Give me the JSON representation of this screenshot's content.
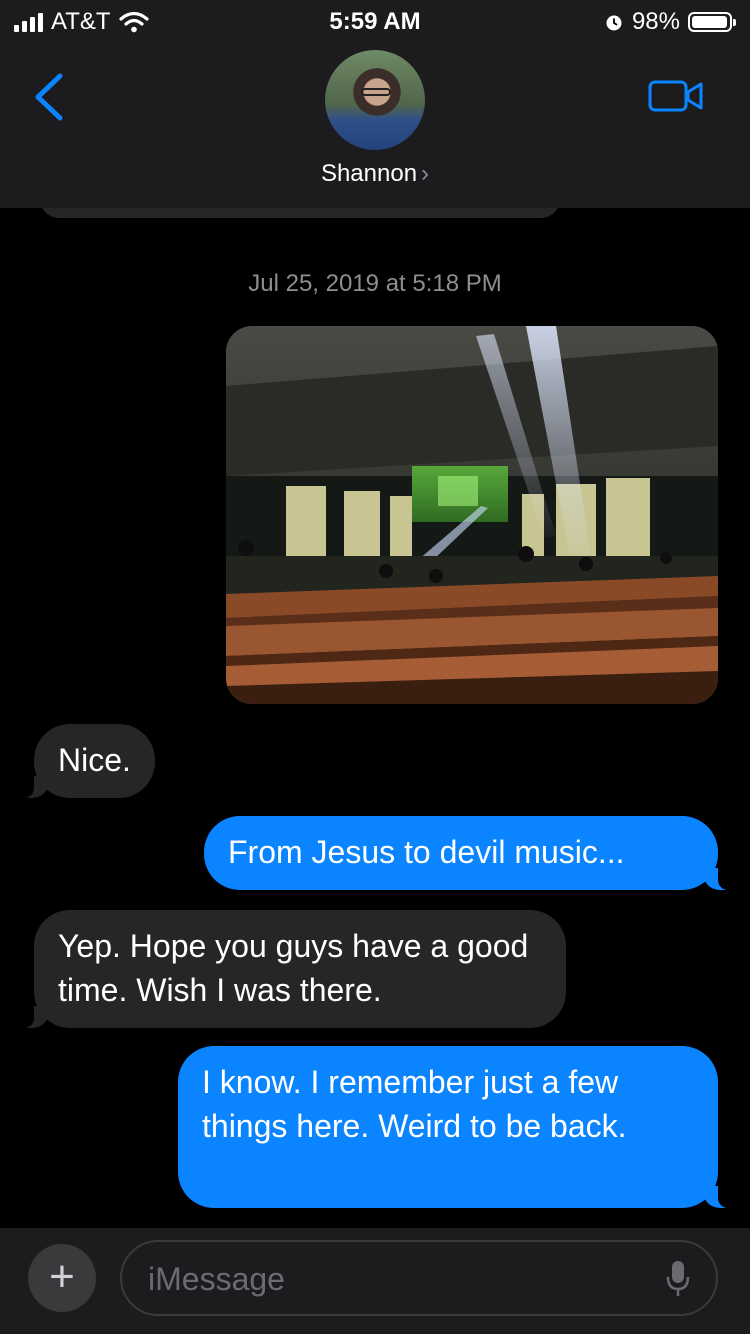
{
  "status_bar": {
    "carrier": "AT&T",
    "time": "5:59 AM",
    "battery_percent": "98%",
    "battery_level": 0.98
  },
  "header": {
    "contact_name": "Shannon",
    "chevron": "›"
  },
  "conversation": {
    "timestamp": "Jul 25, 2019 at 5:18 PM",
    "messages": [
      {
        "from": "me",
        "type": "image"
      },
      {
        "from": "them",
        "text": "Nice."
      },
      {
        "from": "me",
        "text": "From Jesus to devil music..."
      },
      {
        "from": "them",
        "text": "Yep. Hope you guys have a good time. Wish I was there."
      },
      {
        "from": "me",
        "text": "I know. I remember just a few things here. Weird to be back."
      }
    ]
  },
  "input": {
    "plus_label": "+",
    "placeholder": "iMessage"
  },
  "colors": {
    "accent": "#0a84ff",
    "incoming_bubble": "#262628",
    "header_bg": "#1c1c1e"
  }
}
